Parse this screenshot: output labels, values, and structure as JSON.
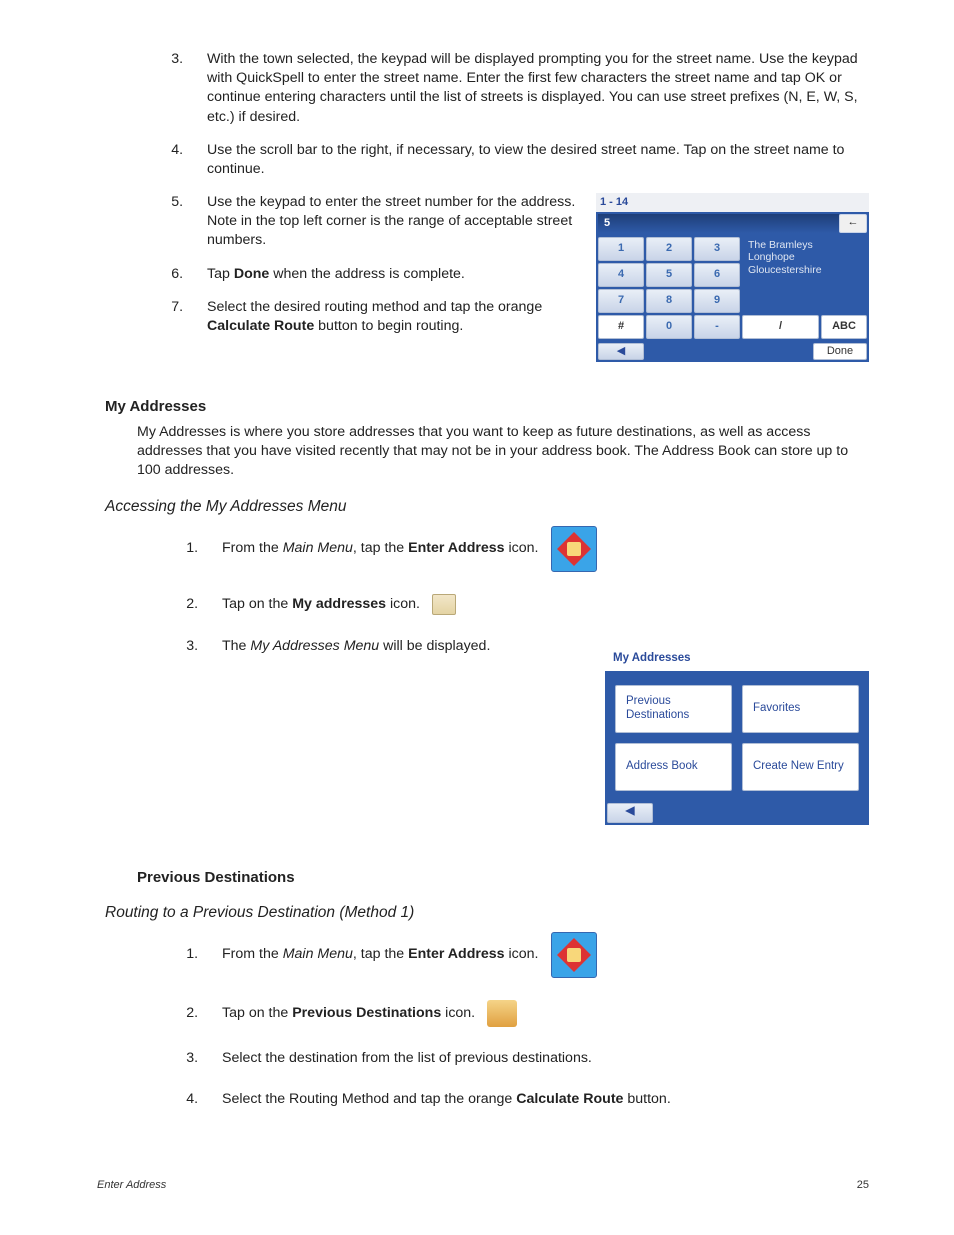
{
  "steps_top": {
    "s3_a": "With the town selected, the keypad will be displayed prompting you for the street name. Use the keypad with QuickSpell to enter the street name. Enter the first few characters the street name and tap OK or continue entering characters until the list of streets is displayed. You can use street prefixes (N, E, W, S, etc.) if desired.",
    "s4": "Use the scroll bar to the right, if necessary, to view the desired street name. Tap on the street name to continue.",
    "s5": "Use the keypad to enter the street number for the address. Note in the top left corner is the range of acceptable street numbers.",
    "s6_a": "Tap ",
    "s6_b": "Done",
    "s6_c": " when the address is complete.",
    "s7_a": "Select the desired routing method and tap the orange ",
    "s7_b": "Calculate Route",
    "s7_c": " button to begin routing."
  },
  "keypad": {
    "range": "1 - 14",
    "value": "5",
    "back": "←",
    "rows": [
      [
        "1",
        "2",
        "3"
      ],
      [
        "4",
        "5",
        "6"
      ],
      [
        "7",
        "8",
        "9"
      ],
      [
        "#",
        "0",
        "-",
        "/",
        "ABC"
      ]
    ],
    "addr1": "The Bramleys",
    "addr2": "Longhope",
    "addr3": "Gloucestershire",
    "nav_back": "◀",
    "done": "Done"
  },
  "my_addresses": {
    "heading": "My Addresses",
    "body": "My Addresses is where you store addresses that you want to keep as future destinations, as well as access addresses that you have visited recently that may not be in your address book. The Address Book can store up to 100 addresses.",
    "sub": "Accessing the My Addresses Menu",
    "s1_a": "From the ",
    "s1_b": "Main Menu",
    "s1_c": ", tap the ",
    "s1_d": "Enter Address",
    "s1_e": " icon.",
    "s2_a": "Tap on the ",
    "s2_b": "My addresses",
    "s2_c": " icon.",
    "s3_a": "The ",
    "s3_b": "My Addresses Menu",
    "s3_c": " will be displayed."
  },
  "menu": {
    "title": "My Addresses",
    "b1": "Previous Destinations",
    "b2": "Favorites",
    "b3": "Address Book",
    "b4": "Create New Entry",
    "nav": "◀"
  },
  "prev_dest": {
    "heading": "Previous Destinations",
    "sub": "Routing to a Previous Destination (Method 1)",
    "s1_a": "From the ",
    "s1_b": "Main Menu",
    "s1_c": ", tap the ",
    "s1_d": "Enter Address",
    "s1_e": " icon.",
    "s2_a": "Tap on the ",
    "s2_b": "Previous Destinations",
    "s2_c": " icon.",
    "s3": "Select the destination from the list of previous destinations.",
    "s4_a": "Select the Routing Method and tap the orange ",
    "s4_b": "Calculate Route",
    "s4_c": " button."
  },
  "footer": {
    "left": "Enter Address",
    "page": "25"
  }
}
